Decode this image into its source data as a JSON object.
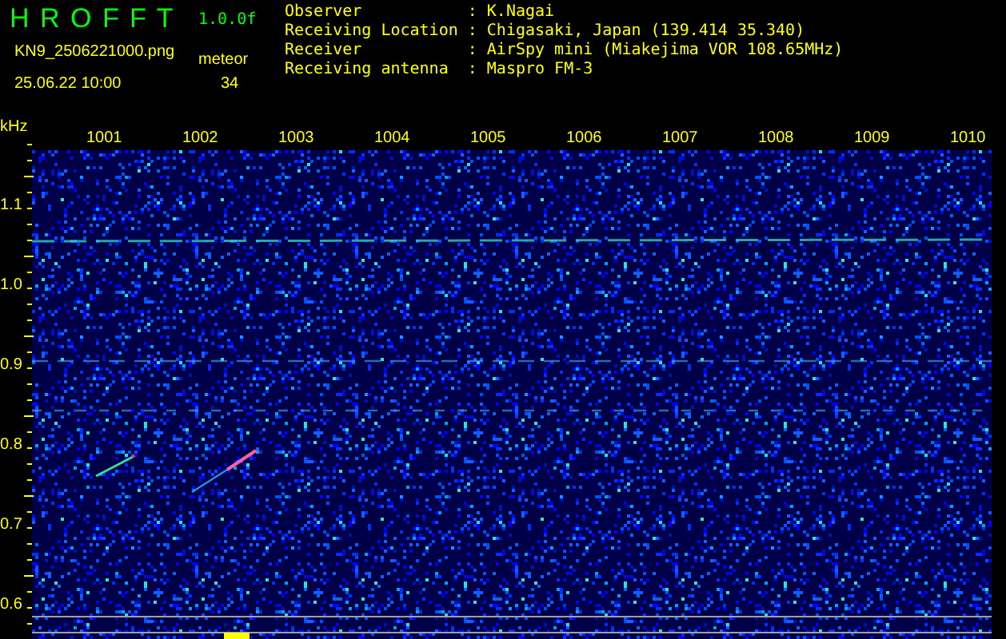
{
  "app": {
    "name": "H R O F F T",
    "version": "1.0.0f",
    "file": "KN9_2506221000.png",
    "datetime": "25.06.22 10:00",
    "count_label": "meteor",
    "count": "34"
  },
  "station": [
    {
      "label": "Observer",
      "separator": ":",
      "value": "K.Nagai"
    },
    {
      "label": "Receiving Location",
      "separator": ":",
      "value": "Chigasaki, Japan (139.414 35.340)"
    },
    {
      "label": "Receiver",
      "separator": ":",
      "value": "AirSpy mini (Miakejima VOR 108.65MHz)"
    },
    {
      "label": "Receiving antenna",
      "separator": ":",
      "value": "Maspro FM-3"
    }
  ],
  "y_axis": {
    "unit": "kHz",
    "labels": [
      "1.1",
      "1.0",
      "0.9",
      "0.8",
      "0.7",
      "0.6"
    ]
  },
  "time_axis": {
    "labels": [
      "1001",
      "1002",
      "1003",
      "1004",
      "1005",
      "1006",
      "1007",
      "1008",
      "1009",
      "1010"
    ]
  }
}
